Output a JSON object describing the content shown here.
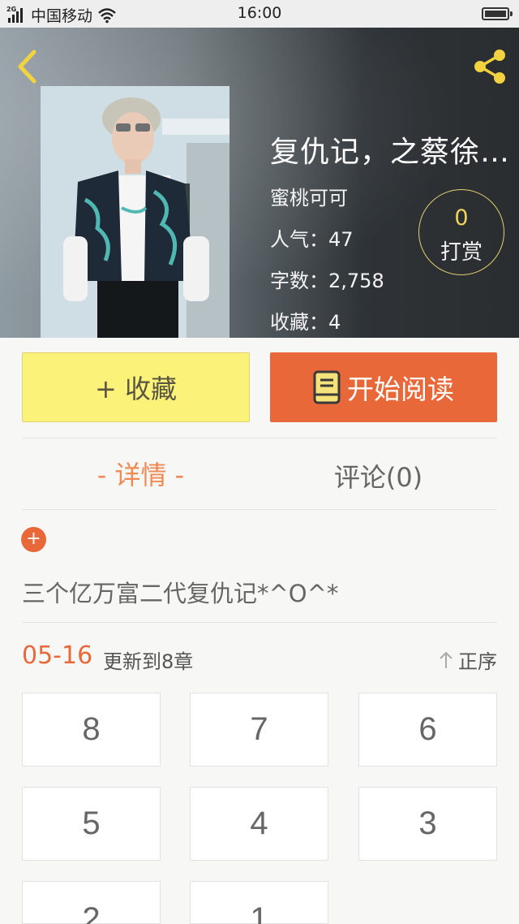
{
  "status_bar": {
    "network_label": "2G",
    "carrier": "中国移动",
    "time": "16:00"
  },
  "book": {
    "title": "复仇记，之蔡徐…",
    "author": "蜜桃可可",
    "popularity_label": "人气：",
    "popularity": "47",
    "word_count_label": "字数：",
    "word_count": "2,758",
    "favorites_label": "收藏：",
    "favorites": "4"
  },
  "reward": {
    "count": "0",
    "label": "打赏"
  },
  "actions": {
    "favorite_label": "+ 收藏",
    "read_label": "开始阅读"
  },
  "tabs": {
    "detail": "- 详情 -",
    "comments": "评论(0)"
  },
  "summary": {
    "plus": "+",
    "text": "三个亿万富二代复仇记*^O^*"
  },
  "updates": {
    "date": "05-16",
    "text": "更新到8章",
    "order_label": "正序"
  },
  "chapters": [
    "8",
    "7",
    "6",
    "5",
    "4",
    "3",
    "2",
    "1"
  ],
  "colors": {
    "accent": "#e9683a",
    "favorite_bg": "#fbf27a",
    "reward_gold": "#f2d35b"
  },
  "icons": {
    "back": "chevron-left-icon",
    "share": "share-icon",
    "book": "book-icon",
    "order": "arrow-up-icon"
  }
}
